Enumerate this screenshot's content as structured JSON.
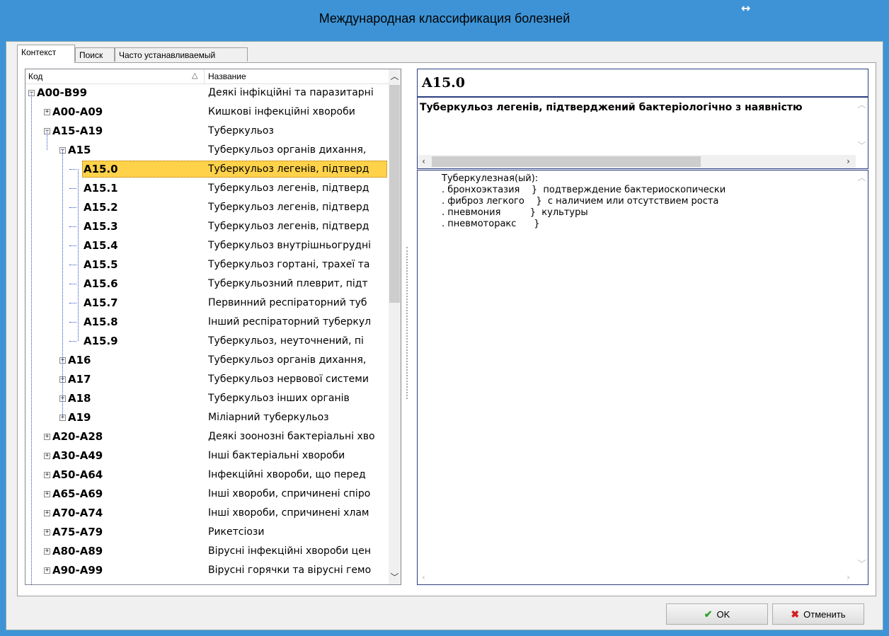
{
  "window": {
    "title": "Международная классификация болезней",
    "resize_glyph": "↔"
  },
  "tabs": [
    "Контекст",
    "Поиск",
    "Часто устанавливаемый"
  ],
  "tree": {
    "columns": {
      "code": "Код",
      "name": "Название"
    },
    "sort_indicator": "△",
    "rows": [
      {
        "code": "A00-B99",
        "name": "Деякі інфікційні та паразитарні",
        "level": 0,
        "exp": "minus"
      },
      {
        "code": "A00-A09",
        "name": "Кишкові інфекційні хвороби",
        "level": 1,
        "exp": "plus"
      },
      {
        "code": "A15-A19",
        "name": "Туберкульоз",
        "level": 1,
        "exp": "minus"
      },
      {
        "code": "A15",
        "name": "Туберкульоз органів дихання,",
        "level": 2,
        "exp": "minus"
      },
      {
        "code": "A15.0",
        "name": "Туберкульоз легенів, підтверд",
        "level": 3,
        "exp": "none",
        "selected": true
      },
      {
        "code": "A15.1",
        "name": "Туберкульоз легенів, підтверд",
        "level": 3,
        "exp": "none"
      },
      {
        "code": "A15.2",
        "name": "Туберкульоз легенів, підтверд",
        "level": 3,
        "exp": "none"
      },
      {
        "code": "A15.3",
        "name": "Туберкульоз легенів, підтверд",
        "level": 3,
        "exp": "none"
      },
      {
        "code": "A15.4",
        "name": "Туберкульоз внутрішньогрудні",
        "level": 3,
        "exp": "none"
      },
      {
        "code": "A15.5",
        "name": "Туберкульоз гортані, трахеї та",
        "level": 3,
        "exp": "none"
      },
      {
        "code": "A15.6",
        "name": "Туберкульозний плеврит, підт",
        "level": 3,
        "exp": "none"
      },
      {
        "code": "A15.7",
        "name": "Первинний респіраторний туб",
        "level": 3,
        "exp": "none"
      },
      {
        "code": "A15.8",
        "name": "Інший респіраторний туберкул",
        "level": 3,
        "exp": "none"
      },
      {
        "code": "A15.9",
        "name": "Туберкульоз, неуточнений, пі",
        "level": 3,
        "exp": "none"
      },
      {
        "code": "A16",
        "name": "Туберкульоз органів дихання,",
        "level": 2,
        "exp": "plus"
      },
      {
        "code": "A17",
        "name": "Туберкульоз нервової системи",
        "level": 2,
        "exp": "plus"
      },
      {
        "code": "A18",
        "name": "Туберкульоз інших органів",
        "level": 2,
        "exp": "plus"
      },
      {
        "code": "A19",
        "name": "Міліарний туберкульоз",
        "level": 2,
        "exp": "plus"
      },
      {
        "code": "A20-A28",
        "name": "Деякі зоонозні бактеріальні хво",
        "level": 1,
        "exp": "plus"
      },
      {
        "code": "A30-A49",
        "name": "Інші бактеріальні хвороби",
        "level": 1,
        "exp": "plus"
      },
      {
        "code": "A50-A64",
        "name": "Інфекційні хвороби, що перед",
        "level": 1,
        "exp": "plus"
      },
      {
        "code": "A65-A69",
        "name": "Інші хвороби, спричинені спіро",
        "level": 1,
        "exp": "plus"
      },
      {
        "code": "A70-A74",
        "name": "Інші хвороби, спричинені хлам",
        "level": 1,
        "exp": "plus"
      },
      {
        "code": "A75-A79",
        "name": "Рикетсіози",
        "level": 1,
        "exp": "plus"
      },
      {
        "code": "A80-A89",
        "name": "Вірусні інфекційні хвороби цен",
        "level": 1,
        "exp": "plus"
      },
      {
        "code": "A90-A99",
        "name": "Вірусні горячки та вірусні гемо",
        "level": 1,
        "exp": "plus"
      }
    ]
  },
  "detail": {
    "code": "A15.0",
    "name": "Туберкульоз легенів, підтверджений бактеріологічно з наявністю",
    "description": [
      "Туберкулезная(ый):",
      ". бронхоэктазия    }  подтверждение бактериоскопически",
      ". фиброз легкого    }  с наличием или отсутствием роста",
      ". пневмония          }  культуры",
      ". пневмоторакс      }"
    ]
  },
  "buttons": {
    "ok": "OK",
    "cancel": "Отменить"
  },
  "colors": {
    "selection": "#ffd24a",
    "ok_icon": "#2aa02a",
    "cancel_icon": "#d02020"
  }
}
